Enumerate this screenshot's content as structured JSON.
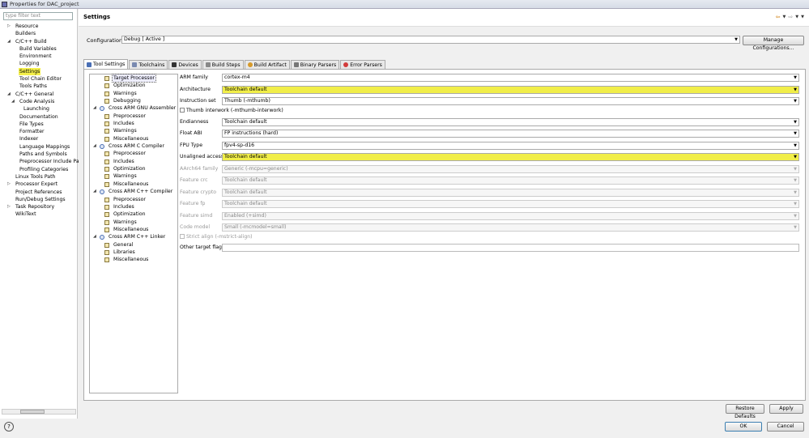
{
  "window": {
    "title": "Properties for DAC_project"
  },
  "left": {
    "filter_placeholder": "type filter text",
    "items": [
      {
        "label": "Resource",
        "indent": 1,
        "exp": "closed"
      },
      {
        "label": "Builders",
        "indent": 1,
        "exp": ""
      },
      {
        "label": "C/C++ Build",
        "indent": 1,
        "exp": "open"
      },
      {
        "label": "Build Variables",
        "indent": 2,
        "exp": ""
      },
      {
        "label": "Environment",
        "indent": 2,
        "exp": ""
      },
      {
        "label": "Logging",
        "indent": 2,
        "exp": ""
      },
      {
        "label": "Settings",
        "indent": 2,
        "exp": "",
        "selected": true
      },
      {
        "label": "Tool Chain Editor",
        "indent": 2,
        "exp": ""
      },
      {
        "label": "Tools Paths",
        "indent": 2,
        "exp": ""
      },
      {
        "label": "C/C++ General",
        "indent": 1,
        "exp": "open"
      },
      {
        "label": "Code Analysis",
        "indent": 2,
        "exp": "open"
      },
      {
        "label": "Launching",
        "indent": 3,
        "exp": ""
      },
      {
        "label": "Documentation",
        "indent": 2,
        "exp": ""
      },
      {
        "label": "File Types",
        "indent": 2,
        "exp": ""
      },
      {
        "label": "Formatter",
        "indent": 2,
        "exp": ""
      },
      {
        "label": "Indexer",
        "indent": 2,
        "exp": ""
      },
      {
        "label": "Language Mappings",
        "indent": 2,
        "exp": ""
      },
      {
        "label": "Paths and Symbols",
        "indent": 2,
        "exp": ""
      },
      {
        "label": "Preprocessor Include Pa",
        "indent": 2,
        "exp": ""
      },
      {
        "label": "Profiling Categories",
        "indent": 2,
        "exp": ""
      },
      {
        "label": "Linux Tools Path",
        "indent": 1,
        "exp": ""
      },
      {
        "label": "Processor Expert",
        "indent": 1,
        "exp": "closed"
      },
      {
        "label": "Project References",
        "indent": 1,
        "exp": ""
      },
      {
        "label": "Run/Debug Settings",
        "indent": 1,
        "exp": ""
      },
      {
        "label": "Task Repository",
        "indent": 1,
        "exp": "closed"
      },
      {
        "label": "WikiText",
        "indent": 1,
        "exp": ""
      }
    ]
  },
  "header": {
    "title": "Settings"
  },
  "configuration": {
    "label": "Configuration:",
    "value": "Debug  [ Active ]",
    "manage_label": "Manage Configurations..."
  },
  "tabs": [
    {
      "label": "Tool Settings",
      "active": true,
      "icon": "tool-settings-icon",
      "color": "#4a6fb5"
    },
    {
      "label": "Toolchains",
      "icon": "toolchains-icon",
      "color": "#7a8ab0"
    },
    {
      "label": "Devices",
      "icon": "devices-icon",
      "color": "#333333"
    },
    {
      "label": "Build Steps",
      "icon": "build-steps-icon",
      "color": "#888888"
    },
    {
      "label": "Build Artifact",
      "icon": "build-artifact-icon",
      "color": "#d69a2a"
    },
    {
      "label": "Binary Parsers",
      "icon": "binary-parsers-icon",
      "color": "#777777"
    },
    {
      "label": "Error Parsers",
      "icon": "error-parsers-icon",
      "color": "#d23b3b"
    }
  ],
  "tool_tree": [
    {
      "label": "Target Processor",
      "indent": 1,
      "exp": "",
      "type": "leaf",
      "selected": true
    },
    {
      "label": "Optimization",
      "indent": 1,
      "exp": "",
      "type": "leaf"
    },
    {
      "label": "Warnings",
      "indent": 1,
      "exp": "",
      "type": "leaf"
    },
    {
      "label": "Debugging",
      "indent": 1,
      "exp": "",
      "type": "leaf"
    },
    {
      "label": "Cross ARM GNU Assembler",
      "indent": 0,
      "exp": "open",
      "type": "tool"
    },
    {
      "label": "Preprocessor",
      "indent": 1,
      "exp": "",
      "type": "leaf"
    },
    {
      "label": "Includes",
      "indent": 1,
      "exp": "",
      "type": "leaf"
    },
    {
      "label": "Warnings",
      "indent": 1,
      "exp": "",
      "type": "leaf"
    },
    {
      "label": "Miscellaneous",
      "indent": 1,
      "exp": "",
      "type": "leaf"
    },
    {
      "label": "Cross ARM C Compiler",
      "indent": 0,
      "exp": "open",
      "type": "tool"
    },
    {
      "label": "Preprocessor",
      "indent": 1,
      "exp": "",
      "type": "leaf"
    },
    {
      "label": "Includes",
      "indent": 1,
      "exp": "",
      "type": "leaf"
    },
    {
      "label": "Optimization",
      "indent": 1,
      "exp": "",
      "type": "leaf"
    },
    {
      "label": "Warnings",
      "indent": 1,
      "exp": "",
      "type": "leaf"
    },
    {
      "label": "Miscellaneous",
      "indent": 1,
      "exp": "",
      "type": "leaf"
    },
    {
      "label": "Cross ARM C++ Compiler",
      "indent": 0,
      "exp": "open",
      "type": "tool"
    },
    {
      "label": "Preprocessor",
      "indent": 1,
      "exp": "",
      "type": "leaf"
    },
    {
      "label": "Includes",
      "indent": 1,
      "exp": "",
      "type": "leaf"
    },
    {
      "label": "Optimization",
      "indent": 1,
      "exp": "",
      "type": "leaf"
    },
    {
      "label": "Warnings",
      "indent": 1,
      "exp": "",
      "type": "leaf"
    },
    {
      "label": "Miscellaneous",
      "indent": 1,
      "exp": "",
      "type": "leaf"
    },
    {
      "label": "Cross ARM C++ Linker",
      "indent": 0,
      "exp": "open",
      "type": "tool"
    },
    {
      "label": "General",
      "indent": 1,
      "exp": "",
      "type": "leaf"
    },
    {
      "label": "Libraries",
      "indent": 1,
      "exp": "",
      "type": "leaf"
    },
    {
      "label": "Miscellaneous",
      "indent": 1,
      "exp": "",
      "type": "leaf"
    }
  ],
  "props": [
    {
      "kind": "select",
      "label": "ARM family",
      "value": "cortex-m4",
      "enabled": true
    },
    {
      "kind": "select",
      "label": "Architecture",
      "value": "Toolchain default",
      "enabled": true,
      "highlight": true
    },
    {
      "kind": "select",
      "label": "Instruction set",
      "value": "Thumb (-mthumb)",
      "enabled": true
    },
    {
      "kind": "check",
      "label": "Thumb interwork (-mthumb-interwork)",
      "enabled": true
    },
    {
      "kind": "select",
      "label": "Endianness",
      "value": "Toolchain default",
      "enabled": true
    },
    {
      "kind": "select",
      "label": "Float ABI",
      "value": "FP instructions (hard)",
      "enabled": true
    },
    {
      "kind": "select",
      "label": "FPU Type",
      "value": "fpv4-sp-d16",
      "enabled": true
    },
    {
      "kind": "select",
      "label": "Unaligned access",
      "value": "Toolchain default",
      "enabled": true,
      "highlight": true
    },
    {
      "kind": "select",
      "label": "AArch64 family",
      "value": "Generic (-mcpu=generic)",
      "enabled": false
    },
    {
      "kind": "select",
      "label": "Feature crc",
      "value": "Toolchain default",
      "enabled": false
    },
    {
      "kind": "select",
      "label": "Feature crypto",
      "value": "Toolchain default",
      "enabled": false
    },
    {
      "kind": "select",
      "label": "Feature fp",
      "value": "Toolchain default",
      "enabled": false
    },
    {
      "kind": "select",
      "label": "Feature simd",
      "value": "Enabled (+simd)",
      "enabled": false
    },
    {
      "kind": "select",
      "label": "Code model",
      "value": "Small (-mcmodel=small)",
      "enabled": false
    },
    {
      "kind": "check",
      "label": "Strict align (-mstrict-align)",
      "enabled": false
    },
    {
      "kind": "text",
      "label": "Other target flags",
      "value": "",
      "enabled": true
    }
  ],
  "buttons": {
    "restore": "Restore Defaults",
    "apply": "Apply",
    "ok": "OK",
    "cancel": "Cancel"
  },
  "help": {
    "glyph": "?"
  },
  "highlight_color": "#f1ee49"
}
